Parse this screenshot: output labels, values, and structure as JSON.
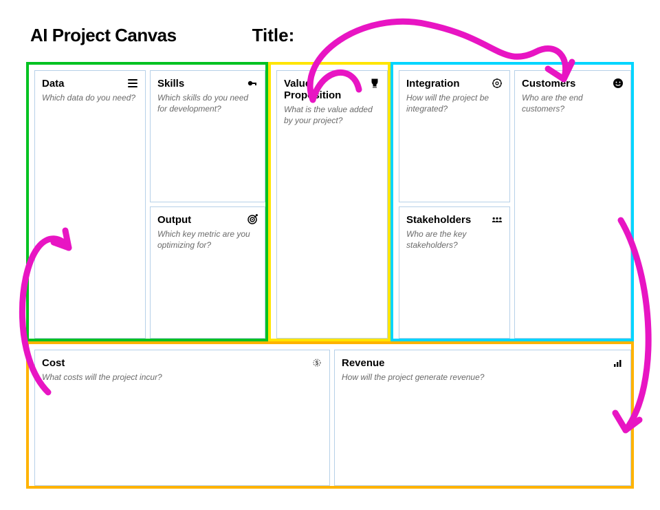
{
  "header": {
    "title": "AI Project Canvas",
    "title_field_label": "Title:"
  },
  "colors": {
    "green": "#00c221",
    "yellow": "#ffe500",
    "cyan": "#00d5ff",
    "orange": "#ffb300",
    "magenta": "#e815c3"
  },
  "blocks": {
    "data": {
      "label": "Data",
      "desc": "Which data do you need?",
      "icon": "list-icon"
    },
    "skills": {
      "label": "Skills",
      "desc": "Which skills do you need for development?",
      "icon": "key-icon"
    },
    "output": {
      "label": "Output",
      "desc": "Which key metric are you optimizing for?",
      "icon": "target-icon"
    },
    "value": {
      "label": "Value Proposition",
      "desc": "What is the value added by your project?",
      "icon": "trophy-icon"
    },
    "integration": {
      "label": "Integration",
      "desc": "How will the project be integrated?",
      "icon": "gear-icon"
    },
    "stakeholders": {
      "label": "Stakeholders",
      "desc": "Who are the key stakeholders?",
      "icon": "people-icon"
    },
    "customers": {
      "label": "Customers",
      "desc": "Who are the end customers?",
      "icon": "face-icon"
    },
    "cost": {
      "label": "Cost",
      "desc": "What costs will the project incur?",
      "icon": "dollar-icon"
    },
    "revenue": {
      "label": "Revenue",
      "desc": "How will the project generate revenue?",
      "icon": "bars-icon"
    }
  }
}
